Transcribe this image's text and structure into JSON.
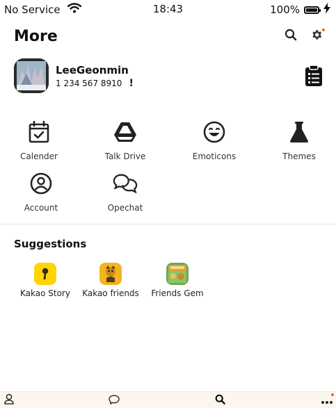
{
  "status": {
    "carrier": "No Service",
    "time": "18:43",
    "battery": "100%",
    "battery_level": 1.0
  },
  "header": {
    "title": "More"
  },
  "profile": {
    "name": "LeeGeonmin",
    "phone": "1 234 567 8910",
    "alert": "!"
  },
  "menu": [
    {
      "label": "Calender",
      "icon": "calendar-check-icon"
    },
    {
      "label": "Talk Drive",
      "icon": "drive-icon"
    },
    {
      "label": "Emoticons",
      "icon": "smiley-icon"
    },
    {
      "label": "Themes",
      "icon": "flask-icon"
    },
    {
      "label": "Account",
      "icon": "user-circle-icon"
    },
    {
      "label": "Opechat",
      "icon": "chat-bubbles-icon"
    }
  ],
  "suggestions": {
    "title": "Suggestions",
    "items": [
      {
        "label": "Kakao Story",
        "icon": "kakao-story-icon",
        "color": "#ffd400"
      },
      {
        "label": "Kakao friends",
        "icon": "kakao-friends-icon",
        "color": "#f2b51d"
      },
      {
        "label": "Friends Gem",
        "icon": "friends-gem-icon",
        "color": "#6ea84d"
      }
    ]
  },
  "tabs": [
    {
      "icon": "person-tab-icon"
    },
    {
      "icon": "chat-tab-icon"
    },
    {
      "icon": "search-tab-icon"
    },
    {
      "icon": "more-tab-icon"
    }
  ],
  "colors": {
    "accent_dot": "#ff5a2a",
    "tabbar_bg": "#fbf7ee"
  }
}
